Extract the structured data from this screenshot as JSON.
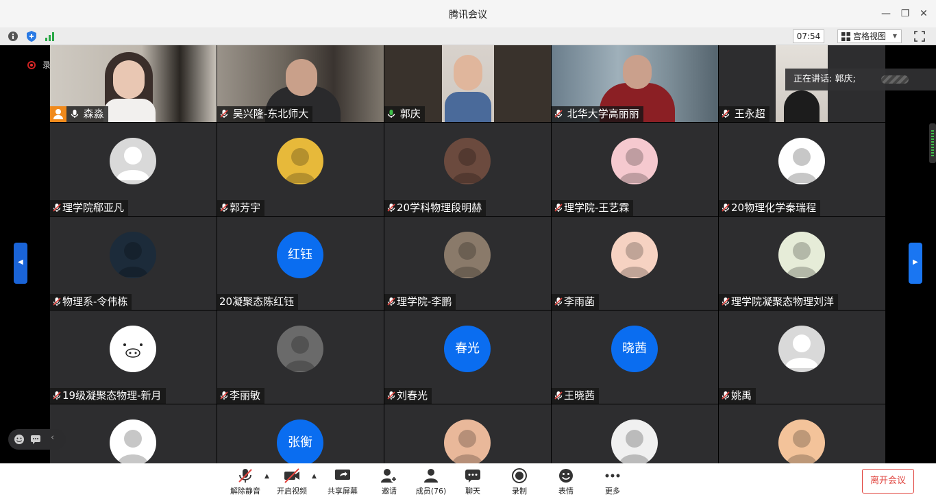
{
  "window": {
    "title": "腾讯会议"
  },
  "statusbar": {
    "clock": "07:54",
    "view_mode": "宫格视图"
  },
  "stage": {
    "recording_label": "录制中",
    "speaking_label": "正在讲话: 郭庆;"
  },
  "participants": [
    {
      "name": "森淼"
    },
    {
      "name": "吴兴隆-东北师大"
    },
    {
      "name": "郭庆"
    },
    {
      "name": "北华大学高丽丽"
    },
    {
      "name": "王永超"
    },
    {
      "name": "理学院郗亚凡"
    },
    {
      "name": "郭芳宇"
    },
    {
      "name": "20学科物理段明赫"
    },
    {
      "name": "理学院-王艺霖"
    },
    {
      "name": "20物理化学秦瑞程"
    },
    {
      "name": "物理系-令伟栋"
    },
    {
      "name": "20凝聚态陈红钰",
      "avatar_text": "红钰"
    },
    {
      "name": "理学院-李鹏"
    },
    {
      "name": "李雨菡"
    },
    {
      "name": "理学院凝聚态物理刘洋"
    },
    {
      "name": "19级凝聚态物理-新月"
    },
    {
      "name": "李丽敏"
    },
    {
      "name": "刘春光",
      "avatar_text": "春光"
    },
    {
      "name": "王晓茜",
      "avatar_text": "晓茜"
    },
    {
      "name": "姚禹"
    },
    {
      "name": ""
    },
    {
      "name": "",
      "avatar_text": "张衡"
    },
    {
      "name": ""
    },
    {
      "name": ""
    },
    {
      "name": ""
    }
  ],
  "toolbar": {
    "unmute": "解除静音",
    "video": "开启视频",
    "share": "共享屏幕",
    "invite": "邀请",
    "members": "成员(76)",
    "chat": "聊天",
    "record": "录制",
    "reactions": "表情",
    "more": "更多",
    "leave": "离开会议"
  },
  "colors": {
    "accent": "#0a6df0",
    "leave": "#e0433d",
    "active_speaker": "#3fbf4a"
  }
}
